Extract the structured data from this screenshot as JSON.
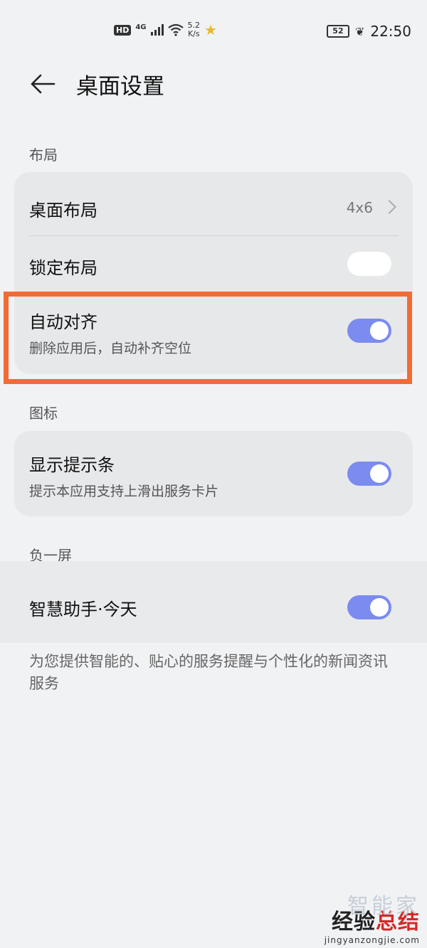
{
  "status_bar": {
    "hd_badge": "HD",
    "network": "4G",
    "speed_value": "5.2",
    "speed_unit": "K/s",
    "battery": "52",
    "time": "22:50"
  },
  "header": {
    "title": "桌面设置"
  },
  "sections": {
    "layout": {
      "label": "布局"
    },
    "icons": {
      "label": "图标"
    },
    "minus_screen": {
      "label": "负一屏"
    }
  },
  "rows": {
    "desktop_layout": {
      "title": "桌面布局",
      "value": "4x6"
    },
    "lock_layout": {
      "title": "锁定布局",
      "state": false
    },
    "auto_align": {
      "title": "自动对齐",
      "subtitle": "删除应用后，自动补齐空位",
      "state": true
    },
    "show_hint": {
      "title": "显示提示条",
      "subtitle": "提示本应用支持上滑出服务卡片",
      "state": true
    },
    "smart_assistant": {
      "title": "智慧助手·今天",
      "state": true
    }
  },
  "footnote": "为您提供智能的、贴心的服务提醒与个性化的新闻资讯服务",
  "watermark": {
    "main_black": "经验",
    "main_red": "总结",
    "ghost": "智能家",
    "url": "jingyanzongjie.com"
  },
  "colors": {
    "accent_toggle": "#7b8bef",
    "highlight_border": "#f26b35",
    "background": "#f1f2f4",
    "card": "#e7e8ea"
  }
}
